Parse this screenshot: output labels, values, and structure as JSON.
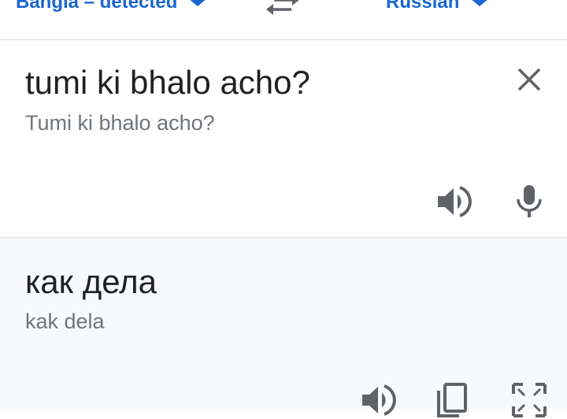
{
  "language_bar": {
    "source_language": "Bangla – detected",
    "target_language": "Russian",
    "accent_color": "#1967d2",
    "icons": [
      "chevron-down-icon",
      "swap-languages-icon"
    ]
  },
  "source": {
    "text": "tumi ki bhalo acho?",
    "transliteration": "Tumi ki bhalo acho?",
    "icons": [
      "close-icon",
      "speaker-icon",
      "microphone-icon"
    ]
  },
  "result": {
    "text": "как дела",
    "transliteration": "kak dela",
    "icons": [
      "speaker-icon",
      "copy-icon",
      "fullscreen-icon"
    ]
  },
  "colors": {
    "primary_text": "#202124",
    "secondary_text": "#70757a",
    "icon": "#5f6368",
    "result_background": "#f8f9fa",
    "divider": "#dadce0"
  }
}
